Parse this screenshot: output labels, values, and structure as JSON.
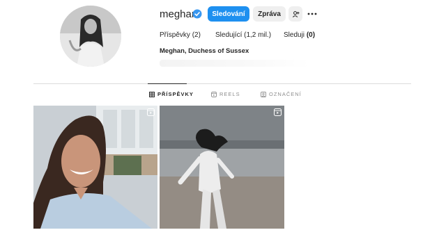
{
  "profile": {
    "username": "meghan",
    "full_name": "Meghan, Duchess of Sussex",
    "verified": true
  },
  "actions": {
    "follow_label": "Sledování",
    "message_label": "Zpráva",
    "suggest_icon": "add-person-icon",
    "more_icon": "more-horizontal-icon"
  },
  "stats": {
    "posts_label": "Příspěvky",
    "posts_value": "(2)",
    "followers_label": "Sledující",
    "followers_value": "(1,2 mil.)",
    "following_label": "Sleduji",
    "following_value": "(0)"
  },
  "tabs": [
    {
      "label": "PŘÍSPĚVKY",
      "icon": "grid-icon",
      "active": true
    },
    {
      "label": "REELS",
      "icon": "reels-icon",
      "active": false
    },
    {
      "label": "OZNAČENÍ",
      "icon": "tagged-icon",
      "active": false
    }
  ],
  "posts": [
    {
      "type": "reel",
      "icon": "reel-badge-icon",
      "description_color": "#c9cfd4"
    },
    {
      "type": "reel",
      "icon": "reel-badge-icon",
      "description_color": "#9a9ea2"
    }
  ],
  "colors": {
    "accent": "#1e90f0",
    "verified": "#3897f0",
    "text": "#262626",
    "muted": "#8e8e8e",
    "divider": "#dbdbdb"
  }
}
